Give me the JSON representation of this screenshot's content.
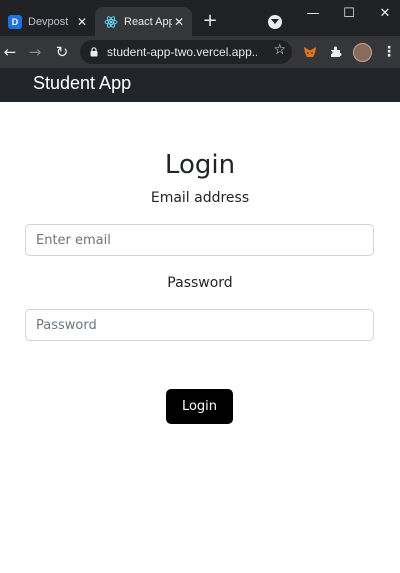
{
  "browser": {
    "tabs": [
      {
        "title": "Devpost",
        "active": false,
        "favicon": "devpost-favicon"
      },
      {
        "title": "React App",
        "active": true,
        "favicon": "react-favicon"
      }
    ],
    "url": "student-app-two.vercel.app..."
  },
  "navbar": {
    "brand": "Student App"
  },
  "form": {
    "title": "Login",
    "email_label": "Email address",
    "email_placeholder": "Enter email",
    "password_label": "Password",
    "password_placeholder": "Password",
    "submit_label": "Login"
  },
  "colors": {
    "navbar_bg": "#212529",
    "button_bg": "#000000",
    "chrome_bg": "#202124",
    "toolbar_bg": "#35363a"
  }
}
